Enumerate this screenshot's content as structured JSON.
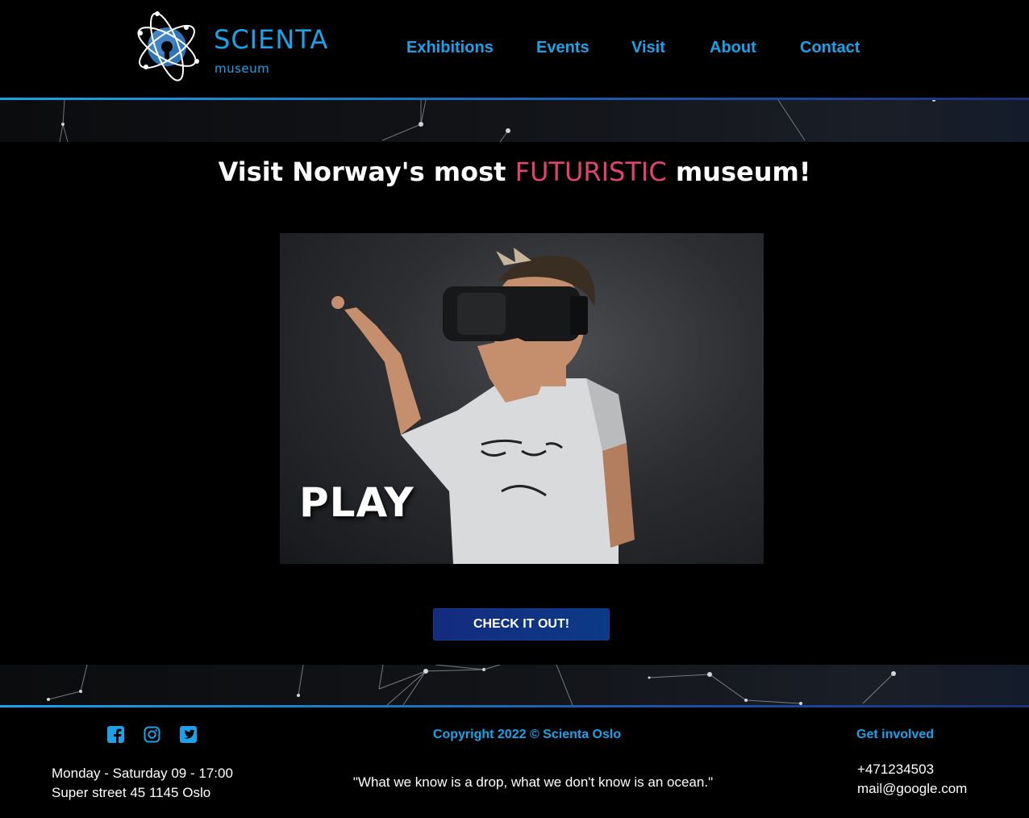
{
  "header": {
    "brand_name": "SCIENTA",
    "brand_sub": "museum",
    "nav": [
      {
        "label": "Exhibitions"
      },
      {
        "label": "Events"
      },
      {
        "label": "Visit"
      },
      {
        "label": "About"
      },
      {
        "label": "Contact"
      }
    ]
  },
  "main": {
    "headline_pre": "Visit Norway's most ",
    "headline_accent": "FUTURISTIC",
    "headline_post": " museum!",
    "hero_overlay": "PLAY",
    "cta_label": "CHECK IT OUT!"
  },
  "footer": {
    "social_icons": [
      "facebook-icon",
      "instagram-icon",
      "twitter-icon"
    ],
    "hours": "Monday - Saturday 09 - 17:00",
    "address": "Super street 45 1145 Oslo",
    "copyright": "Copyright 2022 © Scienta Oslo",
    "quote": "\"What we know is a drop, what we don't know is an ocean.\"",
    "get_involved": "Get involved",
    "phone": "+471234503",
    "email": "mail@google.com"
  },
  "colors": {
    "accent_blue": "#1aa3e8",
    "accent_pink": "#e0436f",
    "button_blue": "#142b7f",
    "background": "#000000"
  }
}
